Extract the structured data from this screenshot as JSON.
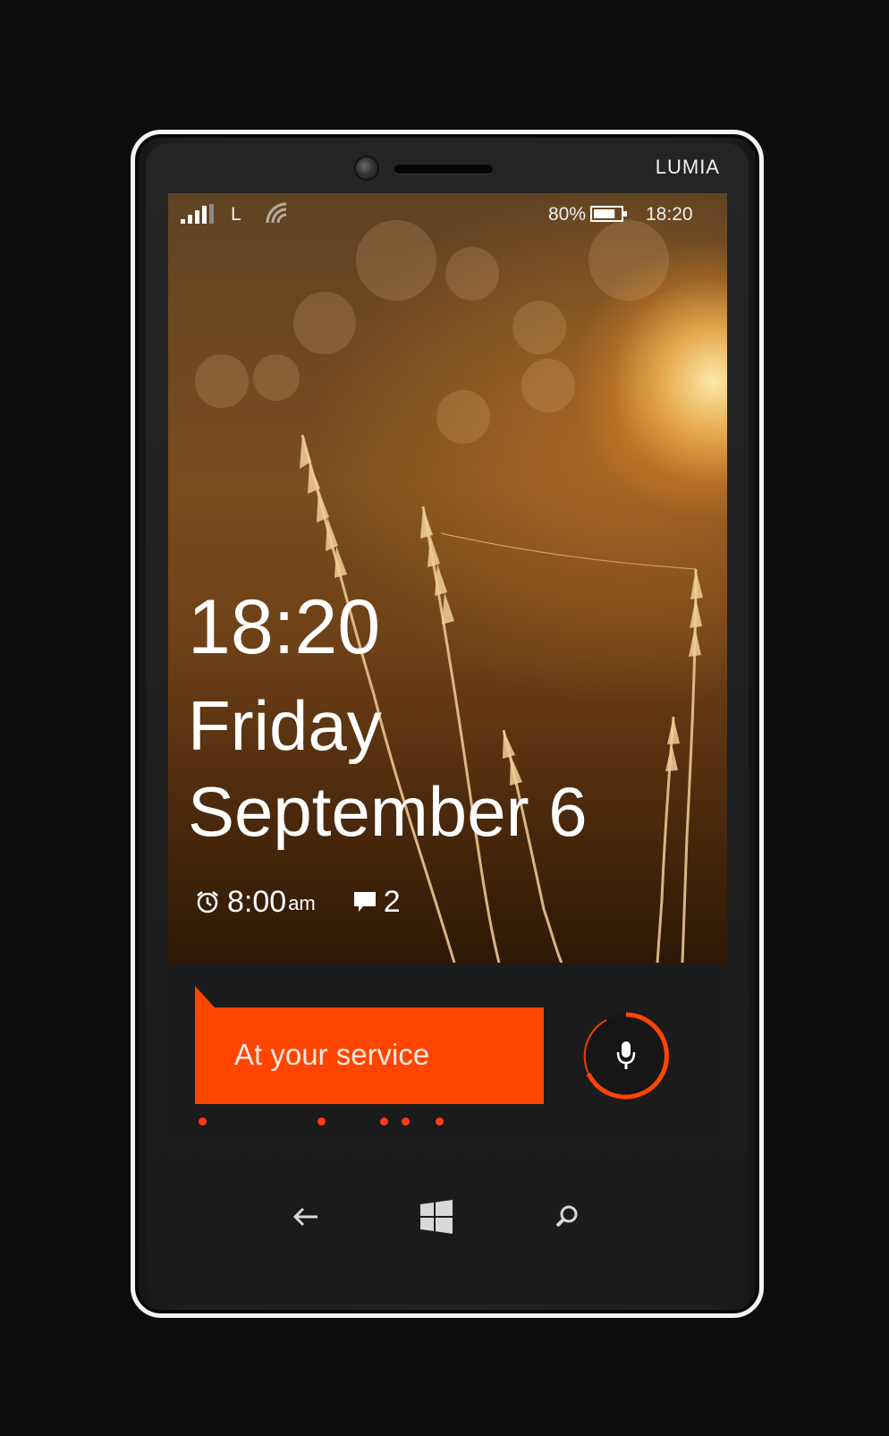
{
  "device": {
    "brand": "LUMIA"
  },
  "status_bar": {
    "signal_icon": "signal-bars-icon",
    "network_type": "L",
    "wifi_icon": "wifi-icon",
    "battery_percent": "80%",
    "battery_level": 0.8,
    "battery_icon": "battery-icon",
    "time": "18:20"
  },
  "lock_screen": {
    "time": "18:20",
    "day": "Friday",
    "date": "September 6",
    "alarm": {
      "icon": "alarm-clock-icon",
      "time": "8:00",
      "suffix": "am"
    },
    "messages": {
      "icon": "message-icon",
      "count": "2"
    }
  },
  "cortana": {
    "prompt": "At your service",
    "mic_icon": "microphone-icon",
    "accent_color": "#ff4500"
  },
  "nav": {
    "back_icon": "back-arrow-icon",
    "start_icon": "windows-logo-icon",
    "search_icon": "search-icon"
  }
}
